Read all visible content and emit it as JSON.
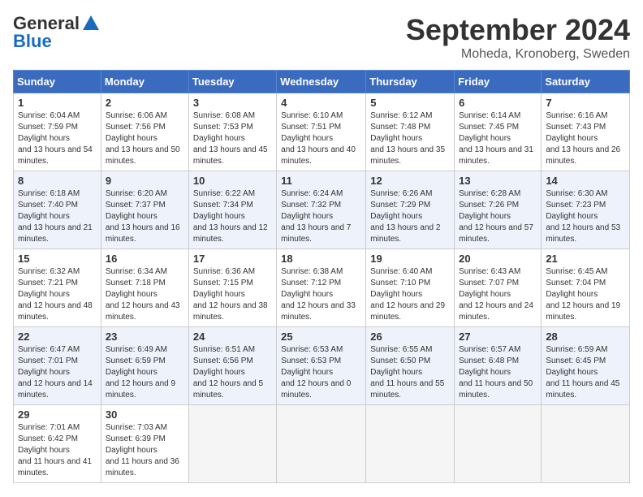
{
  "header": {
    "logo": {
      "general": "General",
      "blue": "Blue"
    },
    "title": "September 2024",
    "location": "Moheda, Kronoberg, Sweden"
  },
  "calendar": {
    "weekdays": [
      "Sunday",
      "Monday",
      "Tuesday",
      "Wednesday",
      "Thursday",
      "Friday",
      "Saturday"
    ],
    "weeks": [
      [
        null,
        {
          "day": "2",
          "sunrise": "6:06 AM",
          "sunset": "7:56 PM",
          "daylight": "13 hours and 50 minutes."
        },
        {
          "day": "3",
          "sunrise": "6:08 AM",
          "sunset": "7:53 PM",
          "daylight": "13 hours and 45 minutes."
        },
        {
          "day": "4",
          "sunrise": "6:10 AM",
          "sunset": "7:51 PM",
          "daylight": "13 hours and 40 minutes."
        },
        {
          "day": "5",
          "sunrise": "6:12 AM",
          "sunset": "7:48 PM",
          "daylight": "13 hours and 35 minutes."
        },
        {
          "day": "6",
          "sunrise": "6:14 AM",
          "sunset": "7:45 PM",
          "daylight": "13 hours and 31 minutes."
        },
        {
          "day": "7",
          "sunrise": "6:16 AM",
          "sunset": "7:43 PM",
          "daylight": "13 hours and 26 minutes."
        }
      ],
      [
        {
          "day": "1",
          "sunrise": "6:04 AM",
          "sunset": "7:59 PM",
          "daylight": "13 hours and 54 minutes."
        },
        null,
        null,
        null,
        null,
        null,
        null
      ],
      [
        {
          "day": "8",
          "sunrise": "6:18 AM",
          "sunset": "7:40 PM",
          "daylight": "13 hours and 21 minutes."
        },
        {
          "day": "9",
          "sunrise": "6:20 AM",
          "sunset": "7:37 PM",
          "daylight": "13 hours and 16 minutes."
        },
        {
          "day": "10",
          "sunrise": "6:22 AM",
          "sunset": "7:34 PM",
          "daylight": "13 hours and 12 minutes."
        },
        {
          "day": "11",
          "sunrise": "6:24 AM",
          "sunset": "7:32 PM",
          "daylight": "13 hours and 7 minutes."
        },
        {
          "day": "12",
          "sunrise": "6:26 AM",
          "sunset": "7:29 PM",
          "daylight": "13 hours and 2 minutes."
        },
        {
          "day": "13",
          "sunrise": "6:28 AM",
          "sunset": "7:26 PM",
          "daylight": "12 hours and 57 minutes."
        },
        {
          "day": "14",
          "sunrise": "6:30 AM",
          "sunset": "7:23 PM",
          "daylight": "12 hours and 53 minutes."
        }
      ],
      [
        {
          "day": "15",
          "sunrise": "6:32 AM",
          "sunset": "7:21 PM",
          "daylight": "12 hours and 48 minutes."
        },
        {
          "day": "16",
          "sunrise": "6:34 AM",
          "sunset": "7:18 PM",
          "daylight": "12 hours and 43 minutes."
        },
        {
          "day": "17",
          "sunrise": "6:36 AM",
          "sunset": "7:15 PM",
          "daylight": "12 hours and 38 minutes."
        },
        {
          "day": "18",
          "sunrise": "6:38 AM",
          "sunset": "7:12 PM",
          "daylight": "12 hours and 33 minutes."
        },
        {
          "day": "19",
          "sunrise": "6:40 AM",
          "sunset": "7:10 PM",
          "daylight": "12 hours and 29 minutes."
        },
        {
          "day": "20",
          "sunrise": "6:43 AM",
          "sunset": "7:07 PM",
          "daylight": "12 hours and 24 minutes."
        },
        {
          "day": "21",
          "sunrise": "6:45 AM",
          "sunset": "7:04 PM",
          "daylight": "12 hours and 19 minutes."
        }
      ],
      [
        {
          "day": "22",
          "sunrise": "6:47 AM",
          "sunset": "7:01 PM",
          "daylight": "12 hours and 14 minutes."
        },
        {
          "day": "23",
          "sunrise": "6:49 AM",
          "sunset": "6:59 PM",
          "daylight": "12 hours and 9 minutes."
        },
        {
          "day": "24",
          "sunrise": "6:51 AM",
          "sunset": "6:56 PM",
          "daylight": "12 hours and 5 minutes."
        },
        {
          "day": "25",
          "sunrise": "6:53 AM",
          "sunset": "6:53 PM",
          "daylight": "12 hours and 0 minutes."
        },
        {
          "day": "26",
          "sunrise": "6:55 AM",
          "sunset": "6:50 PM",
          "daylight": "11 hours and 55 minutes."
        },
        {
          "day": "27",
          "sunrise": "6:57 AM",
          "sunset": "6:48 PM",
          "daylight": "11 hours and 50 minutes."
        },
        {
          "day": "28",
          "sunrise": "6:59 AM",
          "sunset": "6:45 PM",
          "daylight": "11 hours and 45 minutes."
        }
      ],
      [
        {
          "day": "29",
          "sunrise": "7:01 AM",
          "sunset": "6:42 PM",
          "daylight": "11 hours and 41 minutes."
        },
        {
          "day": "30",
          "sunrise": "7:03 AM",
          "sunset": "6:39 PM",
          "daylight": "11 hours and 36 minutes."
        },
        null,
        null,
        null,
        null,
        null
      ]
    ]
  }
}
